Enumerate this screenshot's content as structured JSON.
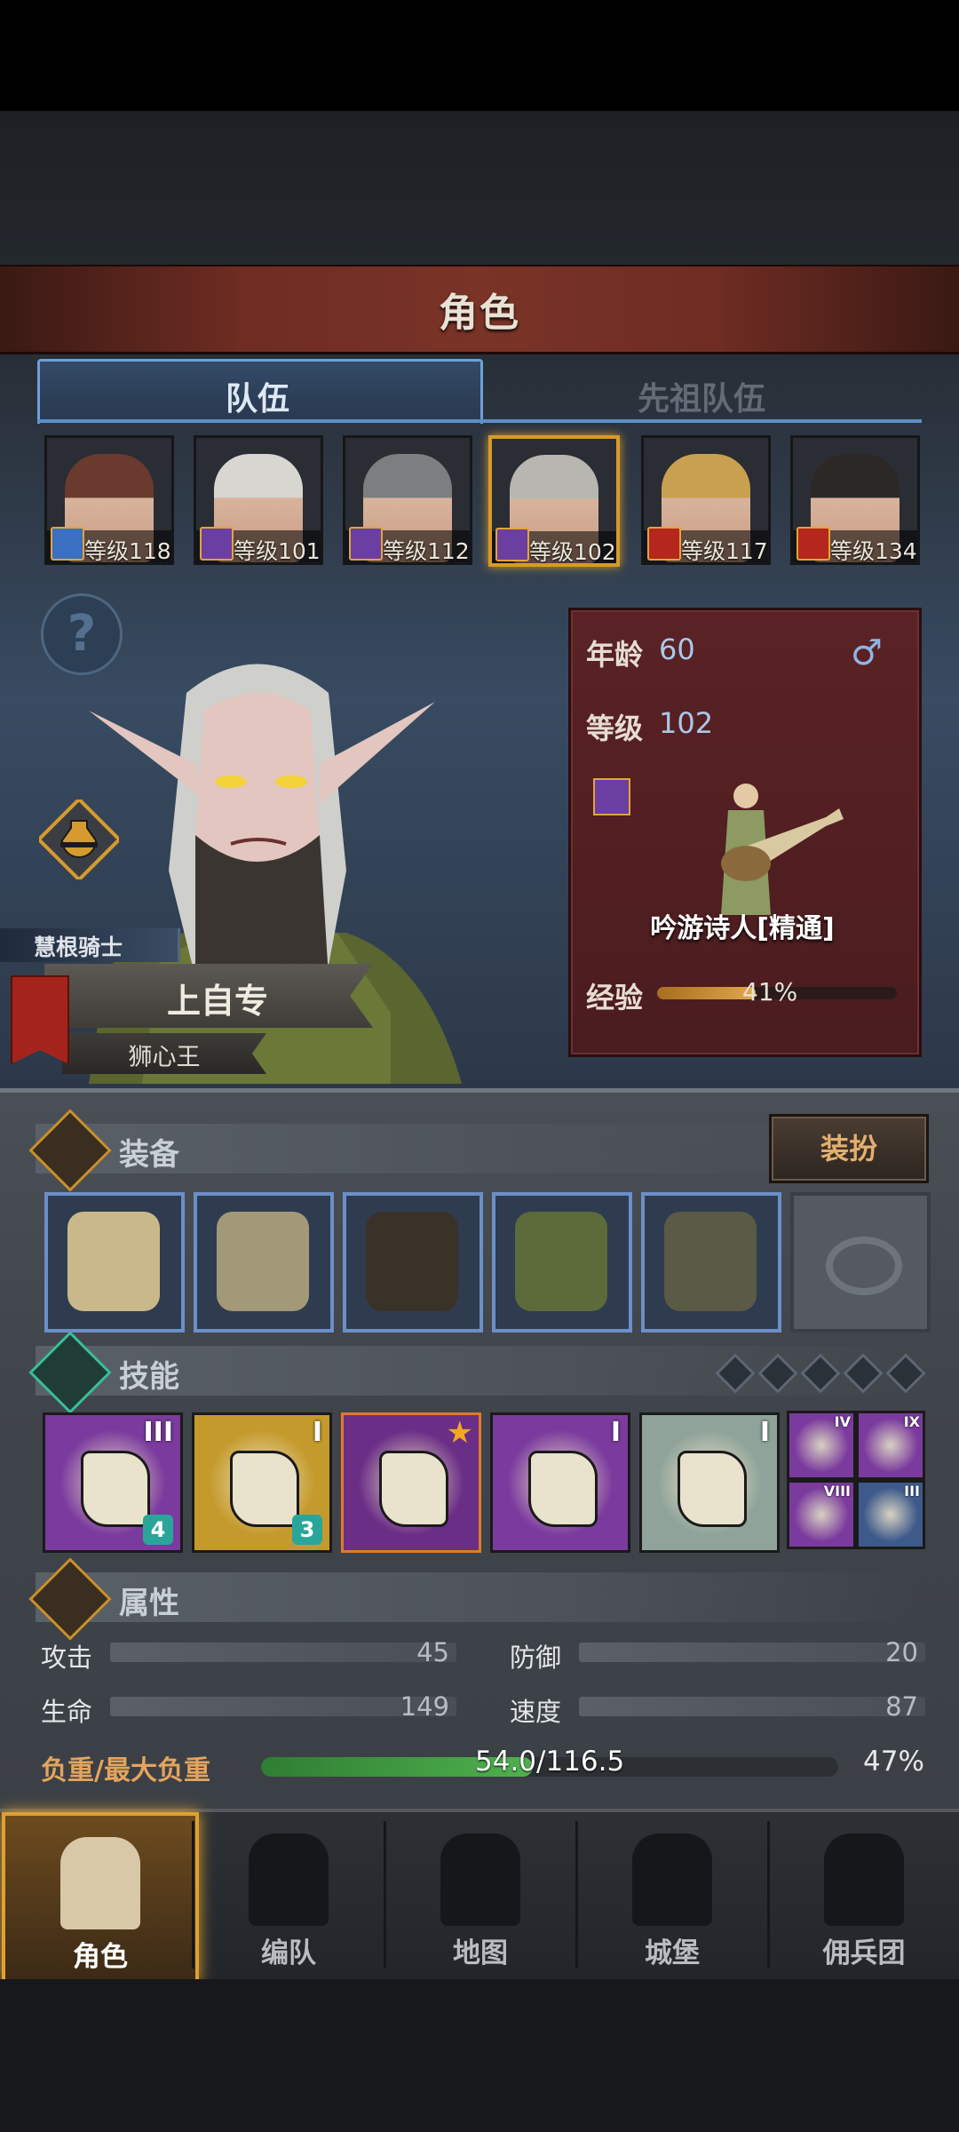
{
  "header": {
    "title": "角色"
  },
  "tabs": [
    {
      "label": "队伍",
      "active": true
    },
    {
      "label": "先祖队伍",
      "active": false
    }
  ],
  "heroes": [
    {
      "level_text": "等级118",
      "badge_color": "#3b6fc1",
      "hair": "#6a3a2e",
      "selected": false
    },
    {
      "level_text": "等级101",
      "badge_color": "#6b3fa1",
      "hair": "#d8d6d0",
      "selected": false
    },
    {
      "level_text": "等级112",
      "badge_color": "#6b3fa1",
      "hair": "#7c7f80",
      "selected": false
    },
    {
      "level_text": "等级102",
      "badge_color": "#6b3fa1",
      "hair": "#b8b6b0",
      "selected": true
    },
    {
      "level_text": "等级117",
      "badge_color": "#b5261c",
      "hair": "#c9a050",
      "selected": false
    },
    {
      "level_text": "等级134",
      "badge_color": "#b5261c",
      "hair": "#2c2826",
      "selected": false
    }
  ],
  "character": {
    "rank": "慧根骑士",
    "name": "上自专",
    "title": "狮心王",
    "age_label": "年龄",
    "age": "60",
    "level_label": "等级",
    "level": "102",
    "class_name": "吟游诗人[精通]",
    "exp_label": "经验",
    "exp_percent_text": "41%",
    "exp_fraction": 0.41
  },
  "equipment": {
    "title": "装备",
    "dress_button": "装扮",
    "slots": [
      {
        "name": "weapon-slot-1",
        "icon": "lance-icon"
      },
      {
        "name": "weapon-slot-2",
        "icon": "lance-icon"
      },
      {
        "name": "helmet-slot",
        "icon": "hood-icon"
      },
      {
        "name": "armor-slot",
        "icon": "tunic-icon"
      },
      {
        "name": "boots-slot",
        "icon": "boots-icon"
      },
      {
        "name": "ring-slot",
        "icon": "ring-icon",
        "empty": true
      }
    ]
  },
  "skills": {
    "title": "技能",
    "slots": [
      {
        "numeral": "III",
        "badge": "4",
        "bg": "#7b3b9e"
      },
      {
        "numeral": "I",
        "badge": "3",
        "bg": "#c59a2c"
      },
      {
        "numeral": "",
        "badge": "",
        "bg": "#6b2e87"
      },
      {
        "numeral": "I",
        "badge": "",
        "bg": "#7b3b9e"
      },
      {
        "numeral": "I",
        "badge": "",
        "bg": "#8fa39a"
      }
    ],
    "mini": [
      {
        "numeral": "IV",
        "bg": "#7b3b9e"
      },
      {
        "numeral": "IX",
        "bg": "#7b3b9e"
      },
      {
        "numeral": "VIII",
        "bg": "#7b3b9e"
      },
      {
        "numeral": "III",
        "bg": "#3d5a8a"
      }
    ]
  },
  "attributes": {
    "title": "属性",
    "attack_label": "攻击",
    "attack": "45",
    "defense_label": "防御",
    "defense": "20",
    "hp_label": "生命",
    "hp": "149",
    "speed_label": "速度",
    "speed": "87",
    "load_label": "负重/最大负重",
    "load_text": "54.0/116.5",
    "load_percent_text": "47%",
    "load_fraction": 0.47
  },
  "nav": [
    {
      "label": "角色",
      "icon": "knight-icon",
      "active": true
    },
    {
      "label": "编队",
      "icon": "helmet-formation-icon",
      "active": false
    },
    {
      "label": "地图",
      "icon": "compass-map-icon",
      "active": false
    },
    {
      "label": "城堡",
      "icon": "castle-icon",
      "active": false
    },
    {
      "label": "佣兵团",
      "icon": "mercenary-banner-icon",
      "active": false
    }
  ]
}
